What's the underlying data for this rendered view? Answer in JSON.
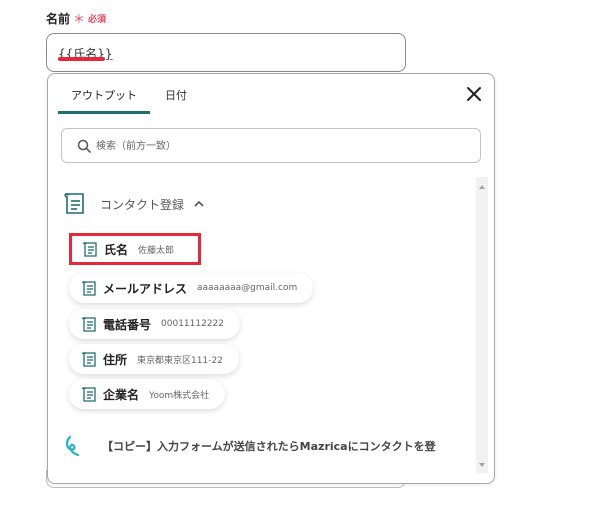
{
  "field": {
    "label": "名前",
    "required_mark": "＊",
    "required_text": "必須",
    "value": "{{氏名}}"
  },
  "tabs": [
    {
      "label": "アウトプット",
      "active": true
    },
    {
      "label": "日付",
      "active": false
    }
  ],
  "search": {
    "placeholder": "検索（前方一致）"
  },
  "section": {
    "title": "コンタクト登録"
  },
  "items": [
    {
      "key": "氏名",
      "value": "佐藤太郎"
    },
    {
      "key": "メールアドレス",
      "value": "aaaaaaaa@gmail.com"
    },
    {
      "key": "電話番号",
      "value": "00011112222"
    },
    {
      "key": "住所",
      "value": "東京都東京区111-22"
    },
    {
      "key": "企業名",
      "value": "Yoom株式会社"
    }
  ],
  "flow": {
    "title": "【コピー】入力フォームが送信されたらMazricaにコンタクトを登"
  },
  "colors": {
    "accent": "#1f6e72",
    "required": "#e8435a",
    "highlight": "#e6283a"
  }
}
